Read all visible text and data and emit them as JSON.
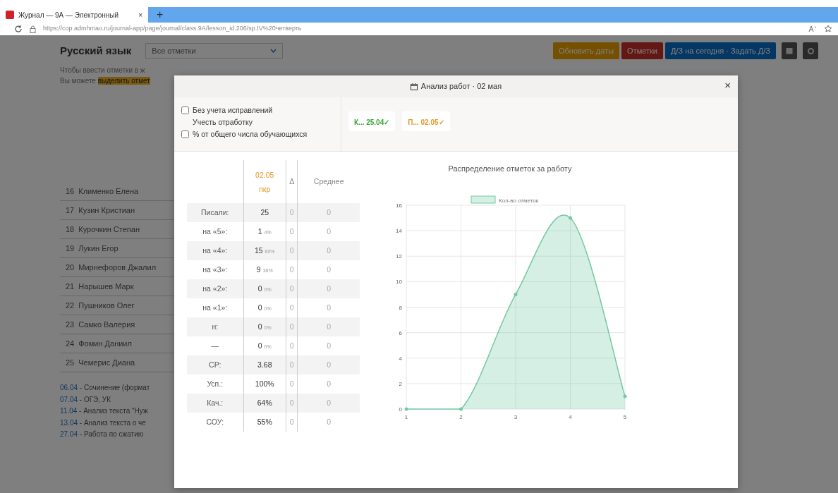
{
  "browser": {
    "tab_title": "Журнал — 9А — Электронный",
    "tab_close": "×",
    "new_tab": "+",
    "url": "https://cop.admhmao.ru/journal-app/page/journal/class.9A/lesson_id.206/sp.IV%20четверть"
  },
  "page": {
    "subject": "Русский язык",
    "filter": "Все отметки",
    "hint": "Чтобы ввести отметки в ж",
    "hint2": "Вы можете",
    "hint2_highlight": "выделить отмет",
    "buttons": [
      {
        "label": "Обновить даты",
        "kind": "warning"
      },
      {
        "label": "Отметки",
        "kind": "danger"
      },
      {
        "label": "Д/З на сегодня · Задать Д/З",
        "kind": "primary"
      }
    ],
    "students": [
      {
        "number": "16",
        "name": "Клименко Елена"
      },
      {
        "number": "17",
        "name": "Кузин Кристиан"
      },
      {
        "number": "18",
        "name": "Курочкин Степан"
      },
      {
        "number": "19",
        "name": "Лукин Егор"
      },
      {
        "number": "20",
        "name": "Мирнефоров Джалил"
      },
      {
        "number": "21",
        "name": "Нарышев Марк"
      },
      {
        "number": "22",
        "name": "Пушников Олег"
      },
      {
        "number": "23",
        "name": "Самко Валерия"
      },
      {
        "number": "24",
        "name": "Фомин Даниил"
      },
      {
        "number": "25",
        "name": "Чемерис Диана"
      }
    ],
    "lessons": [
      {
        "date": "06.04",
        "title": "- Сочинение (формат"
      },
      {
        "date": "07.04",
        "title": "- ОГЭ, УК"
      },
      {
        "date": "11.04",
        "title": "- Анализ текста \"Нуж"
      },
      {
        "date": "13.04",
        "title": "- Анализ текста о че"
      },
      {
        "date": "27.04",
        "title": "- Работа по сжатию"
      }
    ]
  },
  "modal": {
    "title": "Анализ работ · 02 мая",
    "close": "×",
    "options": [
      {
        "kind": "checkbox",
        "label": "Без учета исправлений",
        "checked": false
      },
      {
        "kind": "text",
        "label": "Учесть отработку"
      },
      {
        "kind": "checkbox",
        "label": "% от общего числа обучающихся",
        "checked": false
      }
    ],
    "works": [
      {
        "label": "К...",
        "date": "25.04",
        "mark": "✓",
        "color": "#3aa53a"
      },
      {
        "label": "П...",
        "date": "02.05",
        "mark": "✓",
        "color": "#e09a2a"
      }
    ],
    "table": {
      "columns": [
        {
          "label": "02.05",
          "sub": "пкр"
        },
        {
          "label": "Δ"
        },
        {
          "label": "Среднее"
        }
      ],
      "rows": [
        {
          "label": "Писали:",
          "value": "25",
          "delta": "0",
          "avg": "0"
        },
        {
          "label": "на «5»:",
          "value": "1",
          "percent": "4%",
          "delta": "0",
          "avg": "0"
        },
        {
          "label": "на «4»:",
          "value": "15",
          "percent": "60%",
          "delta": "0",
          "avg": "0"
        },
        {
          "label": "на «3»:",
          "value": "9",
          "percent": "36%",
          "delta": "0",
          "avg": "0"
        },
        {
          "label": "на «2»:",
          "value": "0",
          "percent": "0%",
          "delta": "0",
          "avg": "0"
        },
        {
          "label": "на «1»:",
          "value": "0",
          "percent": "0%",
          "delta": "0",
          "avg": "0"
        },
        {
          "label": "н:",
          "value": "0",
          "percent": "0%",
          "delta": "0",
          "avg": "0"
        },
        {
          "label": "—",
          "value": "0",
          "percent": "0%",
          "delta": "0",
          "avg": "0"
        },
        {
          "label": "СР:",
          "value": "3.68",
          "delta": "0",
          "avg": "0"
        },
        {
          "label": "Усп.:",
          "value": "100%",
          "delta": "0",
          "avg": "0"
        },
        {
          "label": "Кач.:",
          "value": "64%",
          "delta": "0",
          "avg": "0"
        },
        {
          "label": "СОУ:",
          "value": "55%",
          "delta": "0",
          "avg": "0"
        }
      ]
    },
    "chart_data": {
      "type": "area",
      "title": "Распределение отметок за работу",
      "categories": [
        "1",
        "2",
        "3",
        "4",
        "5"
      ],
      "series": [
        {
          "name": "Кол-во отметок",
          "color": "#74c9a4",
          "values": [
            0,
            0,
            9,
            15,
            1
          ]
        }
      ],
      "grid": true,
      "ylim": [
        0,
        16
      ],
      "yticks": [
        0,
        2,
        4,
        6,
        8,
        10,
        12,
        14,
        16
      ]
    }
  }
}
